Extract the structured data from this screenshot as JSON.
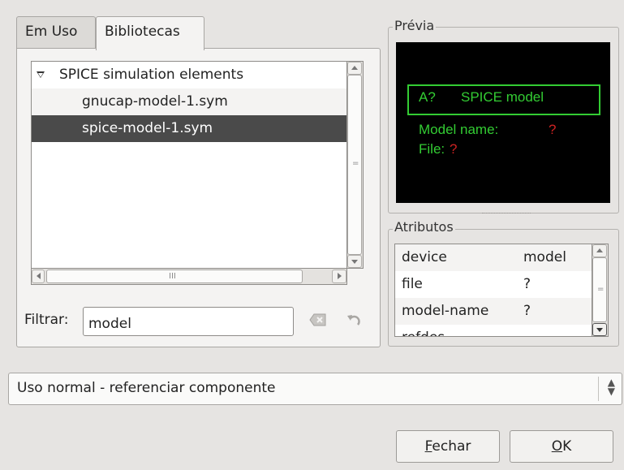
{
  "tabs": [
    {
      "label": "Em Uso",
      "active": false
    },
    {
      "label": "Bibliotecas",
      "active": true
    }
  ],
  "tree": {
    "items": [
      {
        "label": "SPICE simulation elements",
        "type": "group",
        "expanded": true
      },
      {
        "label": "gnucap-model-1.sym",
        "type": "file"
      },
      {
        "label": "spice-model-1.sym",
        "type": "file",
        "selected": true
      }
    ],
    "hscroll_thumb_glyph": "III",
    "vscroll_thumb_glyph": "="
  },
  "filter": {
    "label": "Filtrar:",
    "value": "model"
  },
  "preview": {
    "title": "Prévia",
    "box_label_refdes": "A?",
    "box_label_name": "SPICE model",
    "model_name_label": "Model name:",
    "model_name_value": "?",
    "file_label": "File:",
    "file_value": "?",
    "colors": {
      "background": "#000000",
      "text": "#33cc33",
      "value": "#cc2222"
    }
  },
  "attributes": {
    "title": "Atributos",
    "rows": [
      {
        "key": "device",
        "value": "model"
      },
      {
        "key": "file",
        "value": "?"
      },
      {
        "key": "model-name",
        "value": "?"
      },
      {
        "key": "refdes",
        "value": ""
      }
    ]
  },
  "mode_select": {
    "value": "Uso normal - referenciar componente"
  },
  "buttons": {
    "close": "Fechar",
    "ok": "OK"
  },
  "icons": {
    "clear": "clear-filter-icon",
    "undo": "undo-icon",
    "expander": "expander-down-icon",
    "combo": "up-down-arrows-icon"
  }
}
